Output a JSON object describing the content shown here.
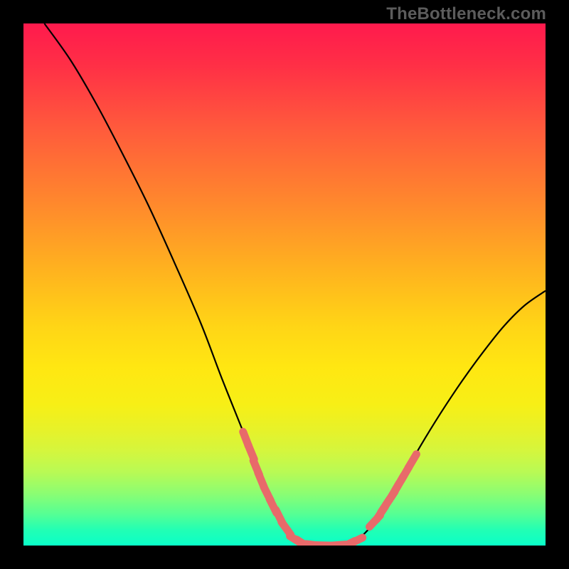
{
  "watermark": {
    "text": "TheBottleneck.com"
  },
  "colors": {
    "background": "#000000",
    "curve": "#000000",
    "dot_fill": "#e86a6a",
    "dot_stroke": "#d85c5c"
  },
  "chart_data": {
    "type": "line",
    "title": "",
    "xlabel": "",
    "ylabel": "",
    "xlim": [
      0,
      100
    ],
    "ylim": [
      0,
      100
    ],
    "curve": [
      {
        "x": 4,
        "y": 100
      },
      {
        "x": 9,
        "y": 93
      },
      {
        "x": 14,
        "y": 84.5
      },
      {
        "x": 19,
        "y": 75
      },
      {
        "x": 24,
        "y": 65
      },
      {
        "x": 29,
        "y": 54
      },
      {
        "x": 34,
        "y": 42.5
      },
      {
        "x": 38,
        "y": 32
      },
      {
        "x": 42,
        "y": 22
      },
      {
        "x": 45,
        "y": 14
      },
      {
        "x": 48,
        "y": 7.5
      },
      {
        "x": 50.5,
        "y": 3
      },
      {
        "x": 53,
        "y": 0.6
      },
      {
        "x": 55,
        "y": 0.15
      },
      {
        "x": 57,
        "y": 0.1
      },
      {
        "x": 60,
        "y": 0.05
      },
      {
        "x": 63,
        "y": 0.55
      },
      {
        "x": 66,
        "y": 3
      },
      {
        "x": 69,
        "y": 7
      },
      {
        "x": 72,
        "y": 12
      },
      {
        "x": 76,
        "y": 19
      },
      {
        "x": 80,
        "y": 25.5
      },
      {
        "x": 84,
        "y": 31.5
      },
      {
        "x": 88,
        "y": 37
      },
      {
        "x": 92,
        "y": 42
      },
      {
        "x": 96,
        "y": 46
      },
      {
        "x": 100,
        "y": 48.8
      }
    ],
    "dots": [
      {
        "x": 42.6,
        "y": 20.4
      },
      {
        "x": 43.6,
        "y": 17.9
      },
      {
        "x": 44.6,
        "y": 14.9
      },
      {
        "x": 45.5,
        "y": 12.6
      },
      {
        "x": 46.7,
        "y": 9.9
      },
      {
        "x": 47.8,
        "y": 7.6
      },
      {
        "x": 49.0,
        "y": 5.5
      },
      {
        "x": 50.3,
        "y": 3.3
      },
      {
        "x": 52.3,
        "y": 1.0
      },
      {
        "x": 53.6,
        "y": 0.33
      },
      {
        "x": 55.7,
        "y": 0.1
      },
      {
        "x": 57.2,
        "y": 0.03
      },
      {
        "x": 60.2,
        "y": 0.08
      },
      {
        "x": 62.1,
        "y": 0.2
      },
      {
        "x": 63.6,
        "y": 0.85
      },
      {
        "x": 67.3,
        "y": 4.7
      },
      {
        "x": 68.5,
        "y": 6.3
      },
      {
        "x": 69.3,
        "y": 7.6
      },
      {
        "x": 70.3,
        "y": 9.1
      },
      {
        "x": 71.2,
        "y": 10.6
      },
      {
        "x": 72.1,
        "y": 12.1
      },
      {
        "x": 73.1,
        "y": 13.8
      },
      {
        "x": 74.5,
        "y": 16.2
      }
    ]
  }
}
